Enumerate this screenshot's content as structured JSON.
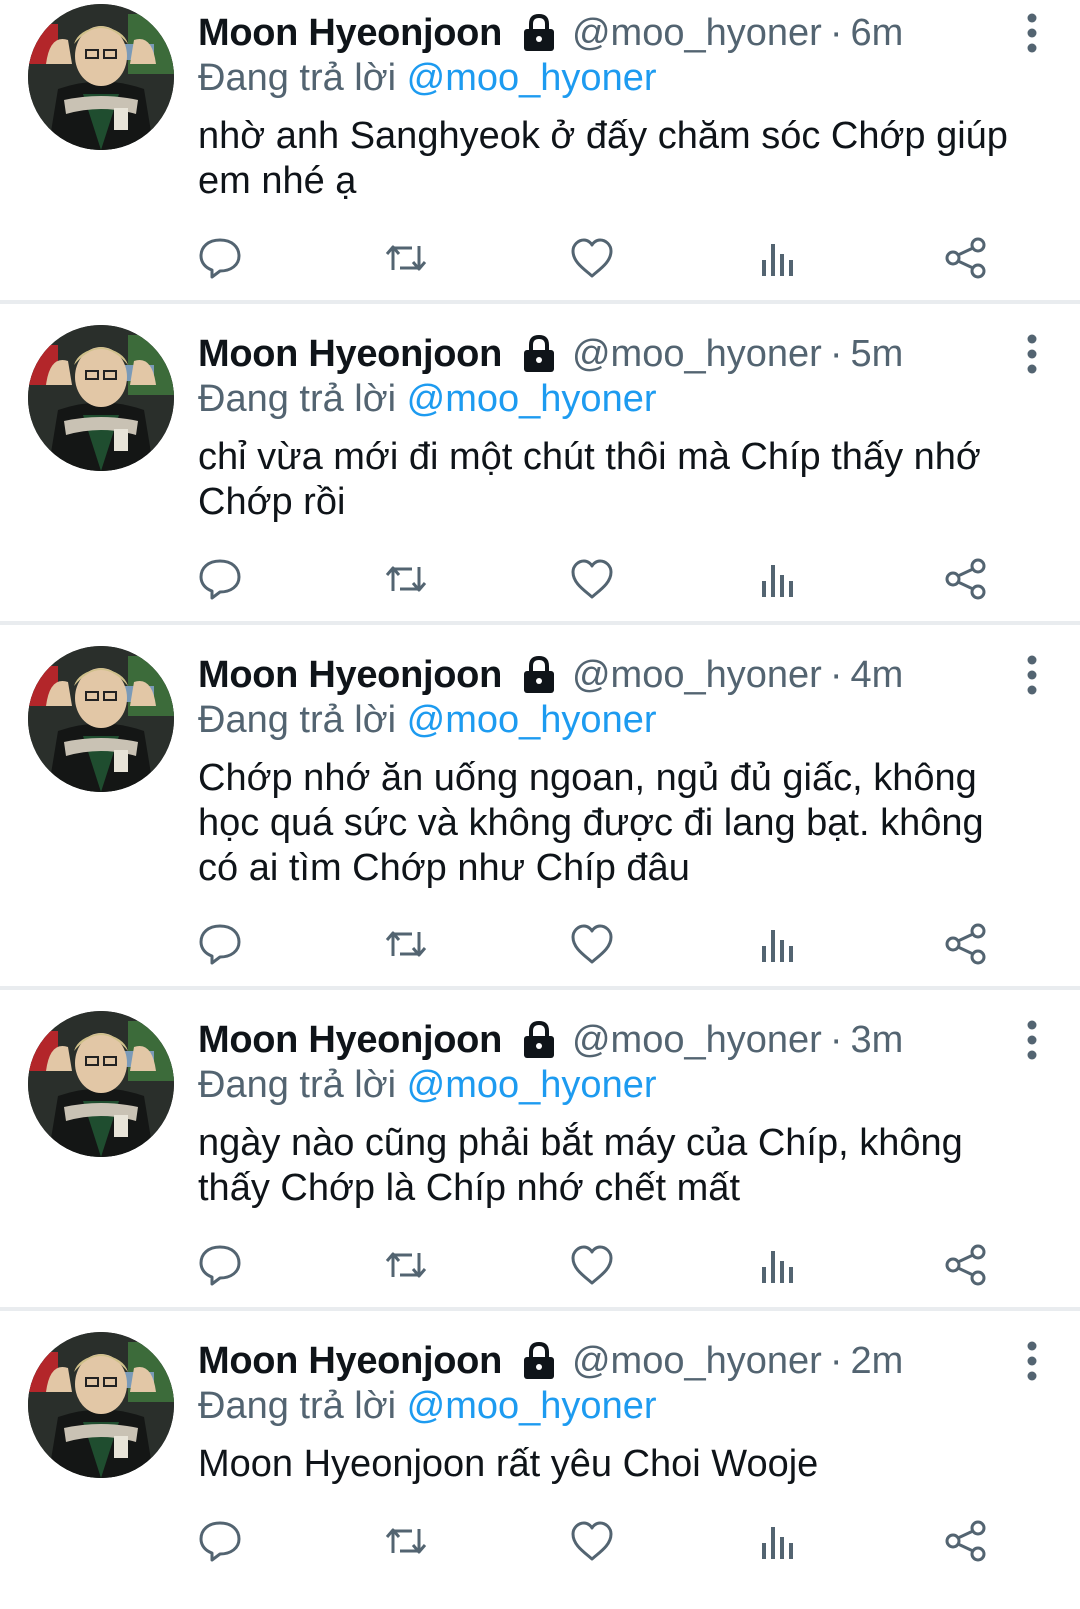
{
  "author": {
    "name": "Moon Hyeonjoon",
    "handle": "@moo_hyoner",
    "protected_icon": "lock-icon"
  },
  "reply_prefix": "Đang trả lời",
  "reply_to": "@moo_hyoner",
  "separator": "·",
  "tweets": [
    {
      "time": "6m",
      "text": "nhờ anh Sanghyeok ở đấy chăm sóc Chớp giúp em nhé ạ"
    },
    {
      "time": "5m",
      "text": "chỉ vừa mới đi một chút thôi mà Chíp thấy nhớ Chớp rồi"
    },
    {
      "time": "4m",
      "text": "Chớp nhớ ăn uống ngoan, ngủ đủ giấc, không học quá sức và không được đi lang bạt. không có ai tìm Chớp như Chíp đâu"
    },
    {
      "time": "3m",
      "text": "ngày nào cũng phải bắt máy của Chíp, không thấy Chớp là Chíp nhớ chết mất"
    },
    {
      "time": "2m",
      "text": "Moon Hyeonjoon rất yêu Choi Wooje"
    }
  ],
  "icons": {
    "reply": "reply-icon",
    "retweet": "retweet-icon",
    "like": "heart-icon",
    "views": "views-icon",
    "share": "share-icon",
    "more": "more-vertical-icon"
  },
  "colors": {
    "text": "#0f1419",
    "secondary": "#536471",
    "link": "#1d9bf0",
    "divider": "#e9ecef"
  }
}
